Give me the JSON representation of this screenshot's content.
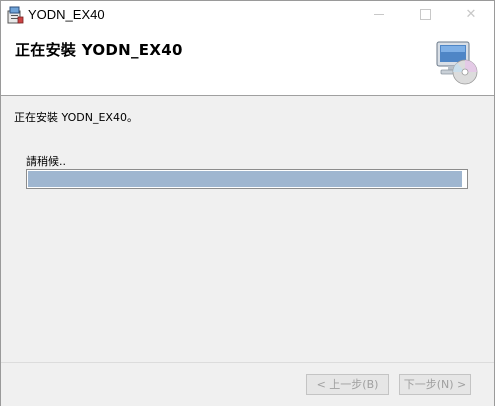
{
  "window": {
    "title": "YODN_EX40",
    "icon": "installer-app-icon",
    "controls": {
      "minimize": "minimize-icon",
      "maximize": "maximize-icon",
      "close_glyph": "✕"
    }
  },
  "banner": {
    "title": "正在安裝 YODN_EX40",
    "graphic": "computer-cd-icon"
  },
  "body": {
    "status_message": "正在安裝 YODN_EX40。",
    "wait_label": "請稍候..",
    "progress": 0.99
  },
  "footer": {
    "back_label": "< 上一步(B)",
    "next_label": "下一步(N) >"
  },
  "colors": {
    "progress_fill": "#9fb6d0",
    "window_bg": "#f0f0f0",
    "banner_bg": "#ffffff"
  }
}
